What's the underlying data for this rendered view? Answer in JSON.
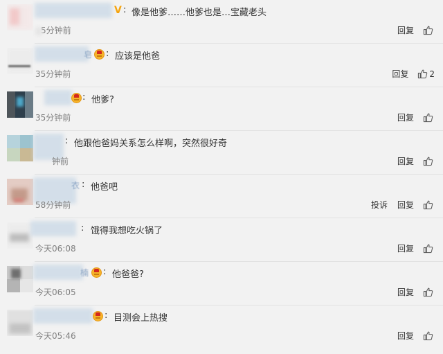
{
  "comments": [
    {
      "name_tail": "",
      "badge": "vip-v",
      "content": "像是他爹……他爹也是…宝藏老头",
      "time": "5分钟前",
      "actions": [
        "回复"
      ],
      "likes": ""
    },
    {
      "name_tail": "皂",
      "badge": "crown-badge-icon",
      "content": "应该是他爸",
      "time": "35分钟前",
      "actions": [
        "回复"
      ],
      "likes": "2"
    },
    {
      "name_tail": "",
      "badge": "crown-badge-icon",
      "content": "他爹?",
      "time": "35分钟前",
      "actions": [
        "回复"
      ],
      "likes": ""
    },
    {
      "name_tail": "",
      "badge": "",
      "content": "他跟他爸妈关系怎么样啊，突然很好奇",
      "time": "钟前",
      "actions": [
        "回复"
      ],
      "likes": ""
    },
    {
      "name_tail": "衣",
      "badge": "",
      "content": "他爸吧",
      "time": "58分钟前",
      "actions": [
        "投诉",
        "回复"
      ],
      "likes": ""
    },
    {
      "name_tail": "",
      "badge": "",
      "content": "饿得我想吃火锅了",
      "time": "今天06:08",
      "actions": [
        "回复"
      ],
      "likes": ""
    },
    {
      "name_tail": "楠",
      "badge": "crown-badge-icon",
      "content": "他爸爸?",
      "time": "今天06:05",
      "actions": [
        "回复"
      ],
      "likes": ""
    },
    {
      "name_tail": "",
      "badge": "crown-badge-icon",
      "content": "目测会上热搜",
      "time": "今天05:46",
      "actions": [
        "回复"
      ],
      "likes": ""
    }
  ],
  "colors": {
    "background": "#f2f2f2",
    "text": "#333333",
    "time": "#808080",
    "badge_gold": "#f6b42a",
    "vip_v": "#f5a40f",
    "username_blur": "#c9d8e6"
  },
  "icons": {
    "like": "thumbs-up-icon",
    "badge": "crown-badge-icon",
    "vip": "vip-v-icon"
  }
}
